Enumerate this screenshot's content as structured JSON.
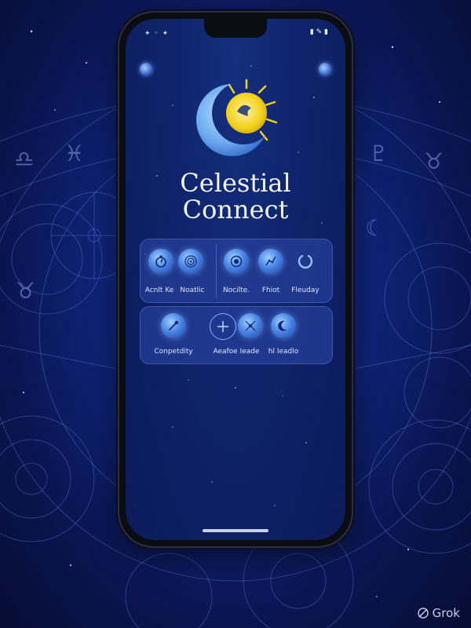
{
  "app": {
    "title_line1": "Celestial",
    "title_line2": "Connect"
  },
  "features_row1": [
    {
      "label": "Acnlt Ke",
      "icon": "stopwatch-icon"
    },
    {
      "label": "Noatlic",
      "icon": "zodiac-wheel-icon"
    },
    {
      "label": "Nocilte.",
      "icon": "orbit-icon"
    },
    {
      "label": "Fhiot",
      "icon": "constellation-icon"
    },
    {
      "label": "Fleuday",
      "icon": "crescent-ring-icon"
    }
  ],
  "features_row2": [
    {
      "label": "Conpetdity",
      "icon": "comet-icon"
    },
    {
      "label": "Aeafoe Ieade",
      "icon": "compass-icon"
    },
    {
      "label": "",
      "icon": "star-chart-icon"
    },
    {
      "label": "hl Ieadlo",
      "icon": "moon-face-icon"
    }
  ],
  "watermark": {
    "text": "Grok"
  },
  "colors": {
    "background": "#0f246c",
    "accent": "#4a86e6",
    "sun": "#f2d21a",
    "text": "#f2f4ff"
  }
}
